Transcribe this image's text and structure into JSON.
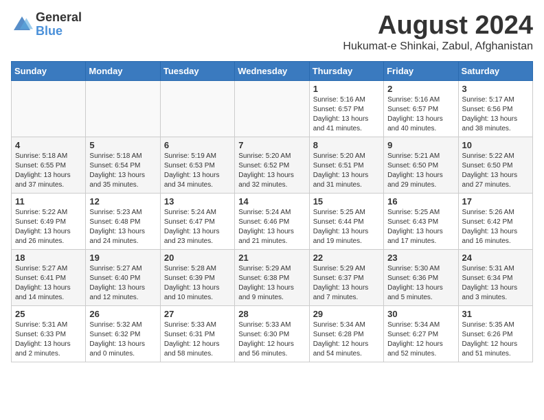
{
  "header": {
    "logo_general": "General",
    "logo_blue": "Blue",
    "month_year": "August 2024",
    "location": "Hukumat-e Shinkai, Zabul, Afghanistan"
  },
  "weekdays": [
    "Sunday",
    "Monday",
    "Tuesday",
    "Wednesday",
    "Thursday",
    "Friday",
    "Saturday"
  ],
  "weeks": [
    [
      {
        "day": "",
        "info": ""
      },
      {
        "day": "",
        "info": ""
      },
      {
        "day": "",
        "info": ""
      },
      {
        "day": "",
        "info": ""
      },
      {
        "day": "1",
        "info": "Sunrise: 5:16 AM\nSunset: 6:57 PM\nDaylight: 13 hours\nand 41 minutes."
      },
      {
        "day": "2",
        "info": "Sunrise: 5:16 AM\nSunset: 6:57 PM\nDaylight: 13 hours\nand 40 minutes."
      },
      {
        "day": "3",
        "info": "Sunrise: 5:17 AM\nSunset: 6:56 PM\nDaylight: 13 hours\nand 38 minutes."
      }
    ],
    [
      {
        "day": "4",
        "info": "Sunrise: 5:18 AM\nSunset: 6:55 PM\nDaylight: 13 hours\nand 37 minutes."
      },
      {
        "day": "5",
        "info": "Sunrise: 5:18 AM\nSunset: 6:54 PM\nDaylight: 13 hours\nand 35 minutes."
      },
      {
        "day": "6",
        "info": "Sunrise: 5:19 AM\nSunset: 6:53 PM\nDaylight: 13 hours\nand 34 minutes."
      },
      {
        "day": "7",
        "info": "Sunrise: 5:20 AM\nSunset: 6:52 PM\nDaylight: 13 hours\nand 32 minutes."
      },
      {
        "day": "8",
        "info": "Sunrise: 5:20 AM\nSunset: 6:51 PM\nDaylight: 13 hours\nand 31 minutes."
      },
      {
        "day": "9",
        "info": "Sunrise: 5:21 AM\nSunset: 6:50 PM\nDaylight: 13 hours\nand 29 minutes."
      },
      {
        "day": "10",
        "info": "Sunrise: 5:22 AM\nSunset: 6:50 PM\nDaylight: 13 hours\nand 27 minutes."
      }
    ],
    [
      {
        "day": "11",
        "info": "Sunrise: 5:22 AM\nSunset: 6:49 PM\nDaylight: 13 hours\nand 26 minutes."
      },
      {
        "day": "12",
        "info": "Sunrise: 5:23 AM\nSunset: 6:48 PM\nDaylight: 13 hours\nand 24 minutes."
      },
      {
        "day": "13",
        "info": "Sunrise: 5:24 AM\nSunset: 6:47 PM\nDaylight: 13 hours\nand 23 minutes."
      },
      {
        "day": "14",
        "info": "Sunrise: 5:24 AM\nSunset: 6:46 PM\nDaylight: 13 hours\nand 21 minutes."
      },
      {
        "day": "15",
        "info": "Sunrise: 5:25 AM\nSunset: 6:44 PM\nDaylight: 13 hours\nand 19 minutes."
      },
      {
        "day": "16",
        "info": "Sunrise: 5:25 AM\nSunset: 6:43 PM\nDaylight: 13 hours\nand 17 minutes."
      },
      {
        "day": "17",
        "info": "Sunrise: 5:26 AM\nSunset: 6:42 PM\nDaylight: 13 hours\nand 16 minutes."
      }
    ],
    [
      {
        "day": "18",
        "info": "Sunrise: 5:27 AM\nSunset: 6:41 PM\nDaylight: 13 hours\nand 14 minutes."
      },
      {
        "day": "19",
        "info": "Sunrise: 5:27 AM\nSunset: 6:40 PM\nDaylight: 13 hours\nand 12 minutes."
      },
      {
        "day": "20",
        "info": "Sunrise: 5:28 AM\nSunset: 6:39 PM\nDaylight: 13 hours\nand 10 minutes."
      },
      {
        "day": "21",
        "info": "Sunrise: 5:29 AM\nSunset: 6:38 PM\nDaylight: 13 hours\nand 9 minutes."
      },
      {
        "day": "22",
        "info": "Sunrise: 5:29 AM\nSunset: 6:37 PM\nDaylight: 13 hours\nand 7 minutes."
      },
      {
        "day": "23",
        "info": "Sunrise: 5:30 AM\nSunset: 6:36 PM\nDaylight: 13 hours\nand 5 minutes."
      },
      {
        "day": "24",
        "info": "Sunrise: 5:31 AM\nSunset: 6:34 PM\nDaylight: 13 hours\nand 3 minutes."
      }
    ],
    [
      {
        "day": "25",
        "info": "Sunrise: 5:31 AM\nSunset: 6:33 PM\nDaylight: 13 hours\nand 2 minutes."
      },
      {
        "day": "26",
        "info": "Sunrise: 5:32 AM\nSunset: 6:32 PM\nDaylight: 13 hours\nand 0 minutes."
      },
      {
        "day": "27",
        "info": "Sunrise: 5:33 AM\nSunset: 6:31 PM\nDaylight: 12 hours\nand 58 minutes."
      },
      {
        "day": "28",
        "info": "Sunrise: 5:33 AM\nSunset: 6:30 PM\nDaylight: 12 hours\nand 56 minutes."
      },
      {
        "day": "29",
        "info": "Sunrise: 5:34 AM\nSunset: 6:28 PM\nDaylight: 12 hours\nand 54 minutes."
      },
      {
        "day": "30",
        "info": "Sunrise: 5:34 AM\nSunset: 6:27 PM\nDaylight: 12 hours\nand 52 minutes."
      },
      {
        "day": "31",
        "info": "Sunrise: 5:35 AM\nSunset: 6:26 PM\nDaylight: 12 hours\nand 51 minutes."
      }
    ]
  ]
}
